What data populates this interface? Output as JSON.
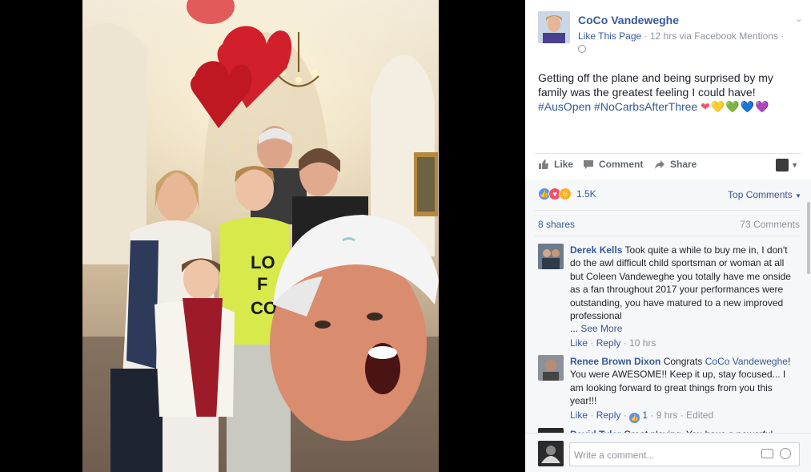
{
  "post": {
    "page_name": "CoCo Vandeweghe",
    "like_page": "Like This Page",
    "sep1": " · ",
    "time": "12 hrs via Facebook Mentions",
    "sep2": " ·",
    "text": "Getting off the plane and being surprised by my family was the greatest feeling I could have!",
    "hashtags": "#AusOpen #NoCarbsAfterThree",
    "hearts": [
      "❤",
      "💛",
      "💚",
      "💙",
      "💜"
    ],
    "heart_colors": [
      "#f1556d",
      "#f7c844",
      "#7ac943",
      "#4a90e2",
      "#9b6bd8"
    ]
  },
  "actions": {
    "like": "Like",
    "comment": "Comment",
    "share": "Share"
  },
  "stats": {
    "reactions_count": "1.5K",
    "top_comments": "Top Comments",
    "shares": "8 shares",
    "comments": "73 Comments"
  },
  "comments": [
    {
      "name": "Derek Kells",
      "text": "Took quite a while to buy me in, I don't do the awl difficult child sportsman or woman at all but Coleen Vandeweghe you totally have me onside as a fan throughout 2017 your performances were outstanding, you have matured to a new improved professional",
      "see_more_prefix": "...",
      "see_more": "See More",
      "like": "Like",
      "reply": "Reply",
      "time": "10 hrs"
    },
    {
      "name": "Renee Brown Dixon",
      "text_pre": "Congrats",
      "mention": "CoCo Vandeweghe",
      "text_post": "! You were AWESOME!! Keep it up, stay focused... I am looking forward to great things from you this year!!!",
      "like": "Like",
      "reply": "Reply",
      "likes": "1",
      "time": "9 hrs",
      "edited": "Edited"
    },
    {
      "name": "David Tyler",
      "text": "Great playing. You have a powerful"
    }
  ],
  "composer": {
    "placeholder": "Write a comment..."
  },
  "colors": {
    "link": "#365899",
    "muted": "#90949c",
    "text": "#1d2129",
    "panel_bg": "#f6f7f9"
  }
}
